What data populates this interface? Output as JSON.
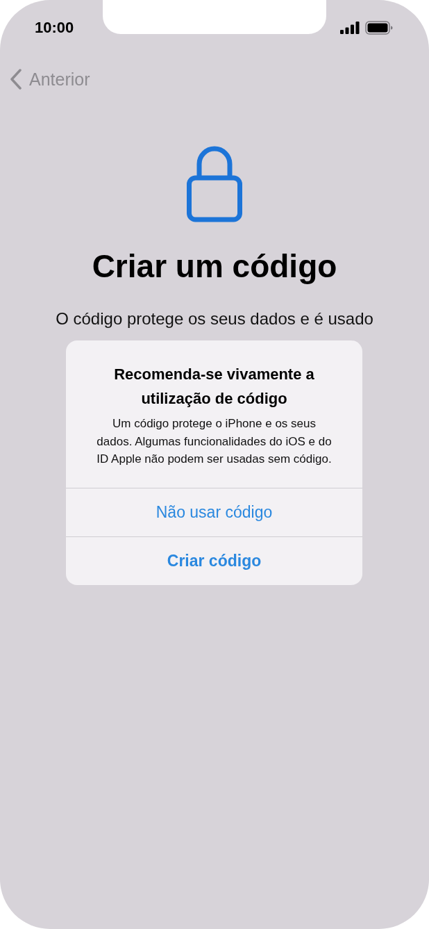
{
  "status_bar": {
    "time": "10:00"
  },
  "nav": {
    "back_label": "Anterior"
  },
  "heading": "Criar um código",
  "description": [
    "O código protege os seus dados e é usado"
  ],
  "alert": {
    "title": "Recomenda-se vivamente a utilização de código",
    "message": "Um código protege o iPhone e os seus dados. Algumas funcionalidades do iOS e do ID Apple não podem ser usadas sem código.",
    "actions": [
      {
        "label": "Não usar código",
        "kind": "default"
      },
      {
        "label": "Criar código",
        "kind": "preferred"
      }
    ]
  }
}
